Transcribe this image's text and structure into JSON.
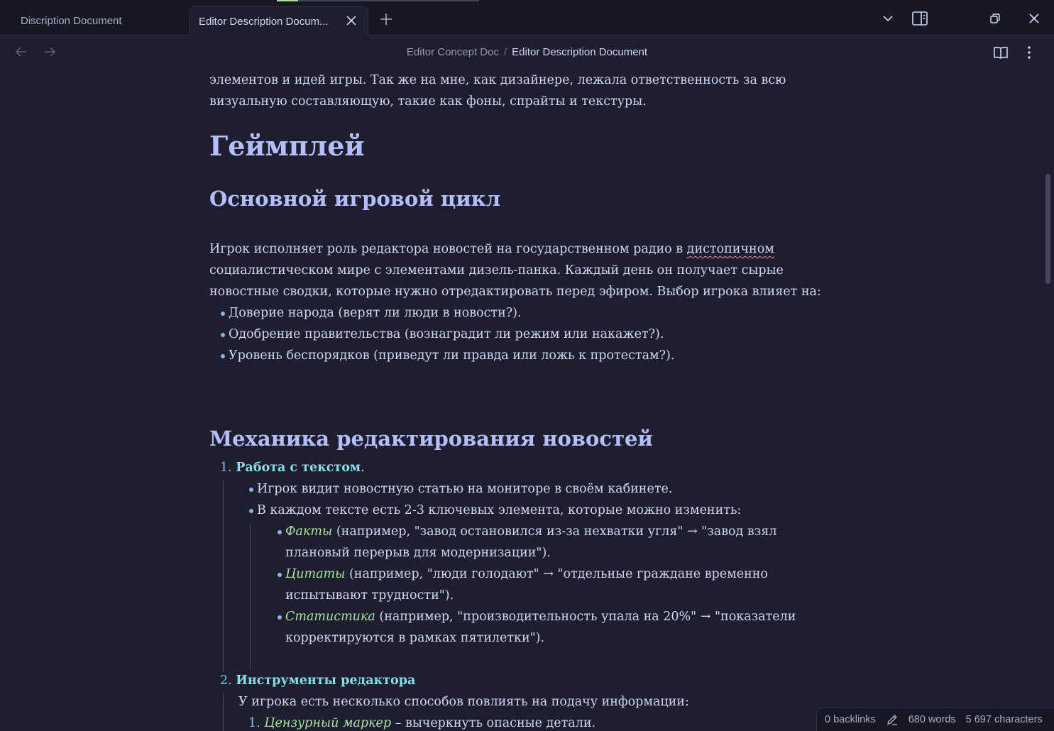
{
  "tabs": [
    {
      "label": "Discription Document",
      "active": false
    },
    {
      "label": "Editor Description Docum...",
      "active": true
    }
  ],
  "breadcrumb": {
    "parent": "Editor Concept Doc",
    "separator": "/",
    "current": "Editor Description Document"
  },
  "document": {
    "intro_lines": [
      "элементов и идей игры. Так же на мне, как дизайнере, лежала ответственность за всю",
      "визуальную составляющую, такие как фоны, спрайты и текстуры."
    ],
    "h1": "Геймплей",
    "h2_loop": "Основной игровой цикл",
    "loop_paragraph": {
      "line1_before": "Игрок исполняет роль редактора новостей на государственном радио в ",
      "line1_misspelled": "дистопичном",
      "line2": "социалистическом мире с элементами дизель-панка. Каждый день он получает сырые",
      "line3": "новостные сводки, которые нужно отредактировать перед эфиром. Выбор игрока влияет на:"
    },
    "loop_bullets": [
      "Доверие народа (верят ли люди в новости?).",
      "Одобрение правительства (вознаградит ли режим или накажет?).",
      "Уровень беспорядков (приведут ли правда или ложь к протестам?)."
    ],
    "h2_mechanics": "Механика редактирования новостей",
    "item1": {
      "number": "1.",
      "title": "Работа с текстом",
      "suffix": ".",
      "bullets": [
        "Игрок видит новостную статью на мониторе в своём кабинете.",
        "В каждом тексте есть 2-3 ключевых элемента, которые можно изменить:"
      ],
      "sub": [
        {
          "term": "Факты",
          "line1": " (например, \"завод остановился из-за нехватки угля\" → \"завод взял",
          "line2": "плановый перерыв для модернизации\")."
        },
        {
          "term": "Цитаты",
          "line1": " (например, \"люди голодают\" → \"отдельные граждане временно",
          "line2": "испытывают трудности\")."
        },
        {
          "term": "Статистика",
          "line1": " (например, \"производительность упала на 20%\" → \"показатели",
          "line2": "корректируются в рамках пятилетки\")."
        }
      ]
    },
    "item2": {
      "number": "2.",
      "title": "Инструменты редактора",
      "intro": "У игрока есть несколько способов повлиять на подачу информации:",
      "sub_number": "1.",
      "sub_term": "Цензурный маркер",
      "sub_text": " – вычеркнуть опасные детали."
    }
  },
  "status": {
    "backlinks": "0 backlinks",
    "words": "680 words",
    "characters": "5 697 characters"
  },
  "icons": {
    "tab_close": "close-icon",
    "tab_new": "plus-icon",
    "tab_list": "chevron-down-icon",
    "sidebar_toggle": "sidebar-toggle-icon",
    "restore": "window-restore-icon",
    "close_window": "close-icon",
    "back": "arrow-left-icon",
    "forward": "arrow-right-icon",
    "reading_mode": "book-open-icon",
    "more": "more-vertical-icon",
    "edit": "pencil-icon"
  },
  "colors": {
    "background": "#1e1e2e",
    "heading": "#b4befe",
    "text": "#cdd6f4",
    "list_marker": "#89b4fa",
    "emphasis": "#a6e3a1",
    "bold_link": "#89dceb"
  }
}
